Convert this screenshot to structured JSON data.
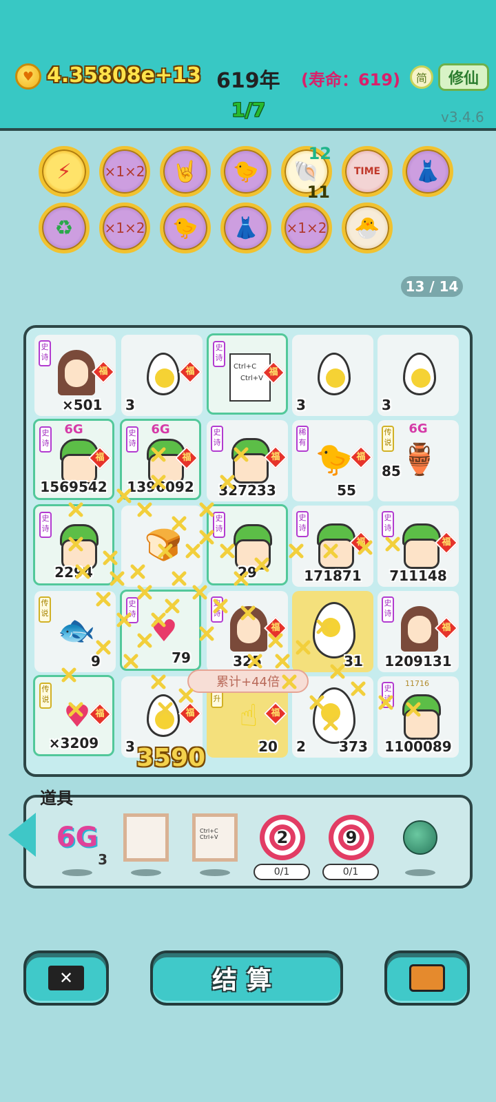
{
  "header": {
    "coins": "4.35808e+13",
    "year": "619年",
    "lifespan": "(寿命：619)",
    "simp_label": "简",
    "xiuxian_label": "修仙",
    "progress": "1/7",
    "version": "v3.4.6"
  },
  "buffs": {
    "row1": [
      {
        "icon": "lightning-icon",
        "glyph": "⚡"
      },
      {
        "icon": "multiplier-scroll-icon",
        "glyph": "×"
      },
      {
        "icon": "rock-hand-icon",
        "glyph": "🤘"
      },
      {
        "icon": "chick-syringe-icon",
        "glyph": "🐤"
      },
      {
        "icon": "shell-icon",
        "glyph": "🐚",
        "count_top": "12",
        "count_bottom": "11"
      },
      {
        "icon": "time-magazine-icon",
        "glyph": "📰"
      },
      {
        "icon": "skirt-icon",
        "glyph": "👗"
      }
    ],
    "row2": [
      {
        "icon": "recycle-icon",
        "glyph": "♻"
      },
      {
        "icon": "multiplier-scroll-icon",
        "glyph": "×"
      },
      {
        "icon": "chick-syringe-icon",
        "glyph": "🐤"
      },
      {
        "icon": "skirt-icon",
        "glyph": "👗"
      },
      {
        "icon": "multiplier-scroll-icon",
        "glyph": "×"
      },
      {
        "icon": "chick-egg-icon",
        "glyph": "🐣"
      }
    ]
  },
  "page_counter": "13 / 14",
  "board": {
    "tags": {
      "epic": "史诗",
      "legend": "传说",
      "rare": "稀有",
      "ascend": "飞升"
    },
    "fu": "福",
    "g6": "6G",
    "cells": [
      {
        "kind": "girl",
        "tag": "史诗",
        "value": "×501"
      },
      {
        "kind": "egg",
        "value": "3"
      },
      {
        "kind": "ctrl",
        "tag": "史诗",
        "ctrl_c": "Ctrl+C",
        "ctrl_v": "Ctrl+V"
      },
      {
        "kind": "egg",
        "value": "3"
      },
      {
        "kind": "egg",
        "value": "3"
      },
      {
        "kind": "man",
        "tag": "史诗",
        "g6": true,
        "value": "1569542"
      },
      {
        "kind": "man",
        "tag": "史诗",
        "g6": true,
        "value": "1396092"
      },
      {
        "kind": "man",
        "tag": "史诗",
        "value": "327233"
      },
      {
        "kind": "chick",
        "tag": "稀有",
        "value": "55"
      },
      {
        "kind": "vase",
        "tag": "传说",
        "g6": true,
        "value": "85"
      },
      {
        "kind": "man",
        "tag": "史诗",
        "value": "2294"
      },
      {
        "kind": "bread",
        "value": ""
      },
      {
        "kind": "man",
        "tag": "史诗",
        "value": "29"
      },
      {
        "kind": "man",
        "tag": "史诗",
        "value": "171871"
      },
      {
        "kind": "man",
        "tag": "史诗",
        "value": "711148"
      },
      {
        "kind": "fish",
        "tag": "传说",
        "value": "9"
      },
      {
        "kind": "heart",
        "tag": "史诗",
        "value": "79"
      },
      {
        "kind": "girl",
        "tag": "史诗",
        "value": "325"
      },
      {
        "kind": "egg",
        "value": "31"
      },
      {
        "kind": "girl",
        "tag": "史诗",
        "value": "1209131"
      },
      {
        "kind": "heart",
        "tag": "传说",
        "value": "×3209"
      },
      {
        "kind": "egg",
        "value": "3"
      },
      {
        "kind": "hand",
        "tag": "飞升",
        "value": "20"
      },
      {
        "kind": "egg",
        "value": "2"
      },
      {
        "kind": "man",
        "tag": "史诗",
        "value": "1100089"
      }
    ],
    "total_pill": "累计+44倍",
    "float_number": "3590",
    "small_badge": "11716",
    "cell_373": "373"
  },
  "items": {
    "title": "道具",
    "g6_label": "6G",
    "g6_count": "3",
    "target1": "2",
    "target1_slot": "0/1",
    "target2": "9",
    "target2_slot": "0/1",
    "ctrl_c": "Ctrl+C",
    "ctrl_v": "Ctrl+V"
  },
  "buttons": {
    "settle_label": "结算"
  }
}
